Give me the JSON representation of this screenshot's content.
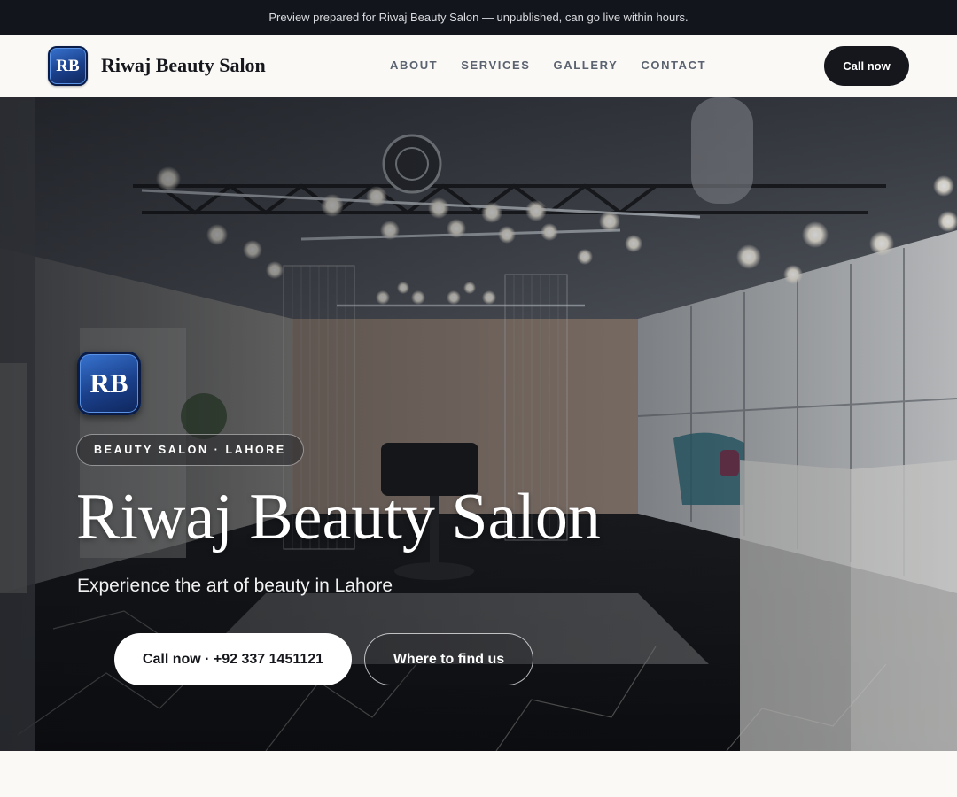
{
  "announcement": "Preview prepared for Riwaj Beauty Salon — unpublished, can go live within hours.",
  "nav": {
    "logo_initials": "RB",
    "brand": "Riwaj Beauty Salon",
    "links": [
      "ABOUT",
      "SERVICES",
      "GALLERY",
      "CONTACT"
    ],
    "cta": "Call now"
  },
  "hero": {
    "logo_initials": "RB",
    "category": "BEAUTY SALON · LAHORE",
    "title": "Riwaj Beauty Salon",
    "tagline": "Experience the art of beauty in Lahore",
    "primary_button": "Call now · +92 337 1451121",
    "secondary_button": "Where to find us",
    "background_image": "salon-interior-photo"
  },
  "colors": {
    "topbar": "#12151b",
    "nav_background": "#faf9f6",
    "dark_button": "#15171c",
    "logo_blue": "#1a3f8a"
  }
}
